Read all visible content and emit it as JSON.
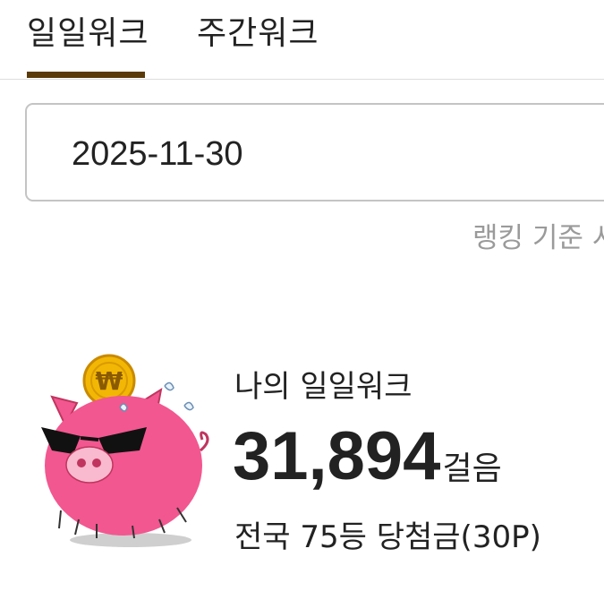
{
  "tabs": [
    {
      "label": "일일워크",
      "active": true
    },
    {
      "label": "주간워크",
      "active": false
    }
  ],
  "date_field": {
    "value": "2025-11-30"
  },
  "ranking_note": "랭킹 기준 시",
  "summary": {
    "title": "나의 일일워크",
    "steps": "31,894",
    "steps_unit": "걸음",
    "rank_text": "전국 75등 당첨금(30P)"
  },
  "mascot": {
    "coin_symbol": "₩",
    "icon": "piggy-bank-sunglasses"
  },
  "colors": {
    "accent": "#5a3a08",
    "pig": "#f2578f",
    "coin": "#f2b705"
  }
}
